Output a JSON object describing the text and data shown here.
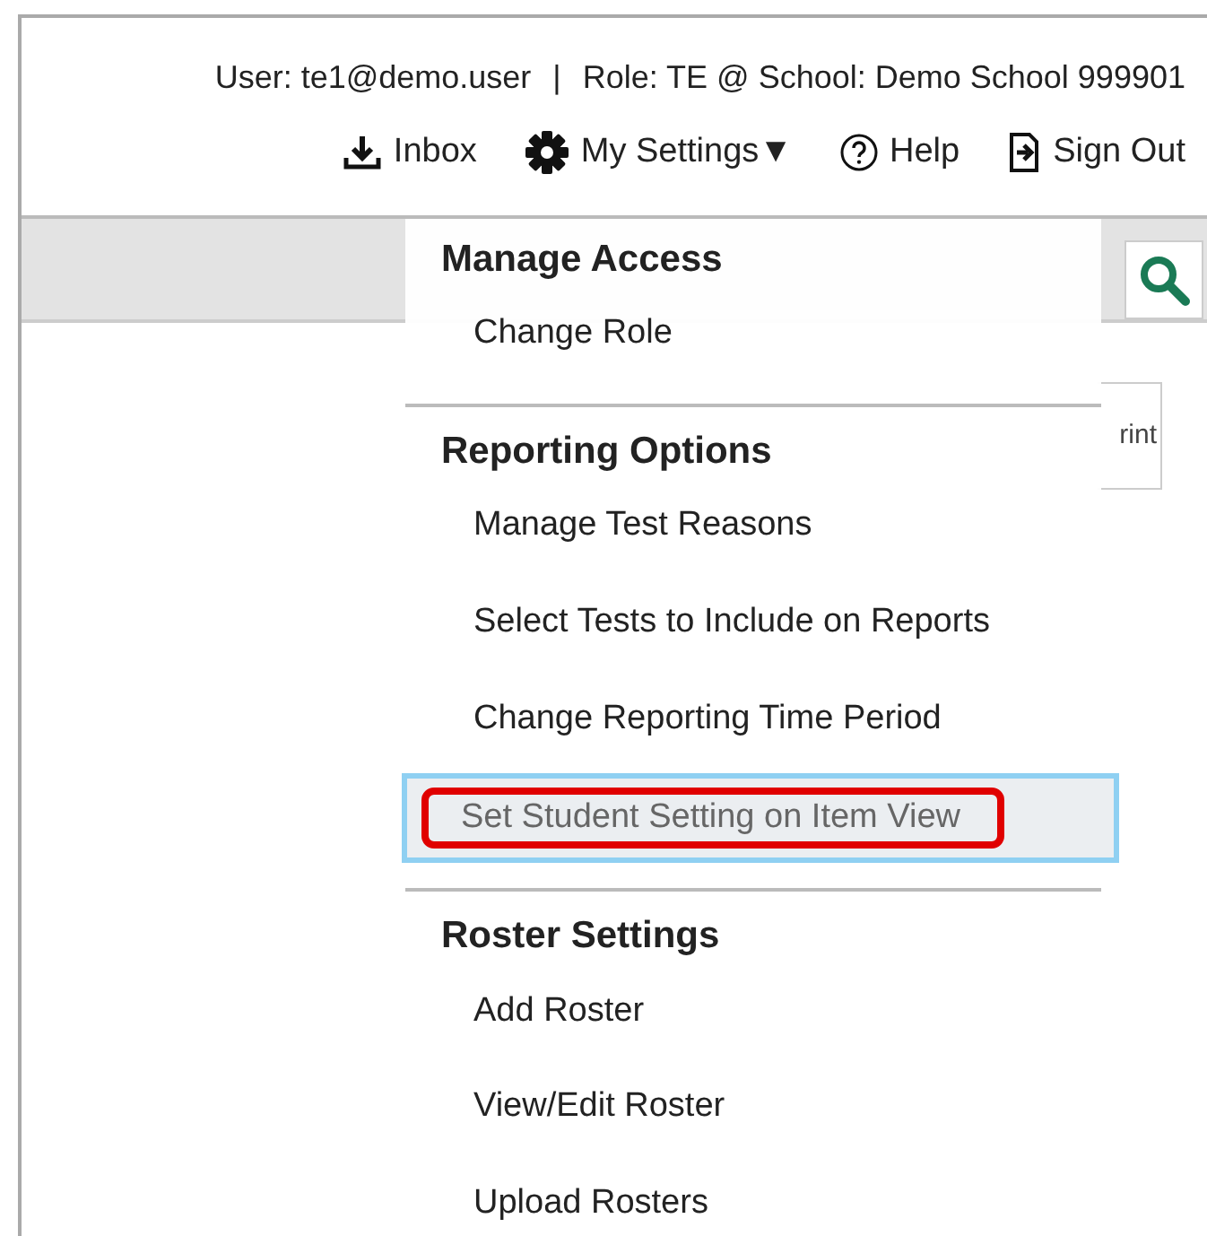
{
  "header": {
    "user": "User: te1@demo.user",
    "separator": "|",
    "role": "Role: TE @ School: Demo School 999901"
  },
  "nav": [
    {
      "kind": "inbox",
      "label": "Inbox"
    },
    {
      "kind": "settings",
      "label": "My Settings",
      "caret": "▼"
    },
    {
      "kind": "help",
      "label": "Help"
    },
    {
      "kind": "signout",
      "label": "Sign Out"
    }
  ],
  "toolbar": {
    "print_label": "rint"
  },
  "menu": [
    {
      "heading": "Manage Access",
      "items": [
        {
          "label": "Change Role",
          "selected": false
        }
      ]
    },
    {
      "heading": "Reporting Options",
      "items": [
        {
          "label": "Manage Test Reasons",
          "selected": false
        },
        {
          "label": "Select Tests to Include on Reports",
          "selected": false
        },
        {
          "label": "Change Reporting Time Period",
          "selected": false
        },
        {
          "label": "Set Student Setting on Item View",
          "selected": true
        }
      ]
    },
    {
      "heading": "Roster Settings",
      "items": [
        {
          "label": "Add Roster",
          "selected": false
        },
        {
          "label": "View/Edit Roster",
          "selected": false
        },
        {
          "label": "Upload Rosters",
          "selected": false
        }
      ]
    }
  ]
}
